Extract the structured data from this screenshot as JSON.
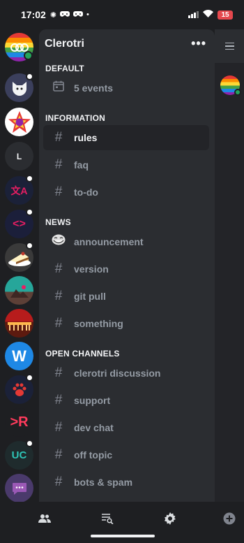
{
  "status_bar": {
    "time": "17:02",
    "battery": "15"
  },
  "server": {
    "name": "Clerotri",
    "menu_label": "•••"
  },
  "rail": {
    "text_servers": [
      {
        "label": "L",
        "bg": "#2b2d31",
        "color": "#f2f3f5"
      },
      {
        "label": "UC",
        "bg": "#1f2b2d",
        "color": "#2ec4b6"
      }
    ],
    "translate_glyph": "文A",
    "brackets_glyph": "<>",
    "w_glyph": "W",
    "r_glyph": ">R"
  },
  "categories": {
    "default": "DEFAULT",
    "information": "INFORMATION",
    "news": "NEWS",
    "open_channels": "OPEN CHANNELS"
  },
  "channels": {
    "events": "5 events",
    "rules": "rules",
    "faq": "faq",
    "todo": "to-do",
    "announcement": "announcement",
    "version": "version",
    "git_pull": "git pull",
    "something": "something",
    "clerotri_discussion": "clerotri discussion",
    "support": "support",
    "dev_chat": "dev chat",
    "off_topic": "off topic",
    "bots_spam": "bots & spam"
  },
  "icons": {
    "hash": "#",
    "channel": "hash-icon",
    "calendar": "calendar-icon",
    "trollface": "trollface-icon"
  },
  "colors": {
    "background": "#1e1f22",
    "panel": "#2b2d31",
    "active_row": "#232428",
    "muted_text": "#949ba4",
    "online": "#23a55a",
    "battery": "#e5484d"
  }
}
